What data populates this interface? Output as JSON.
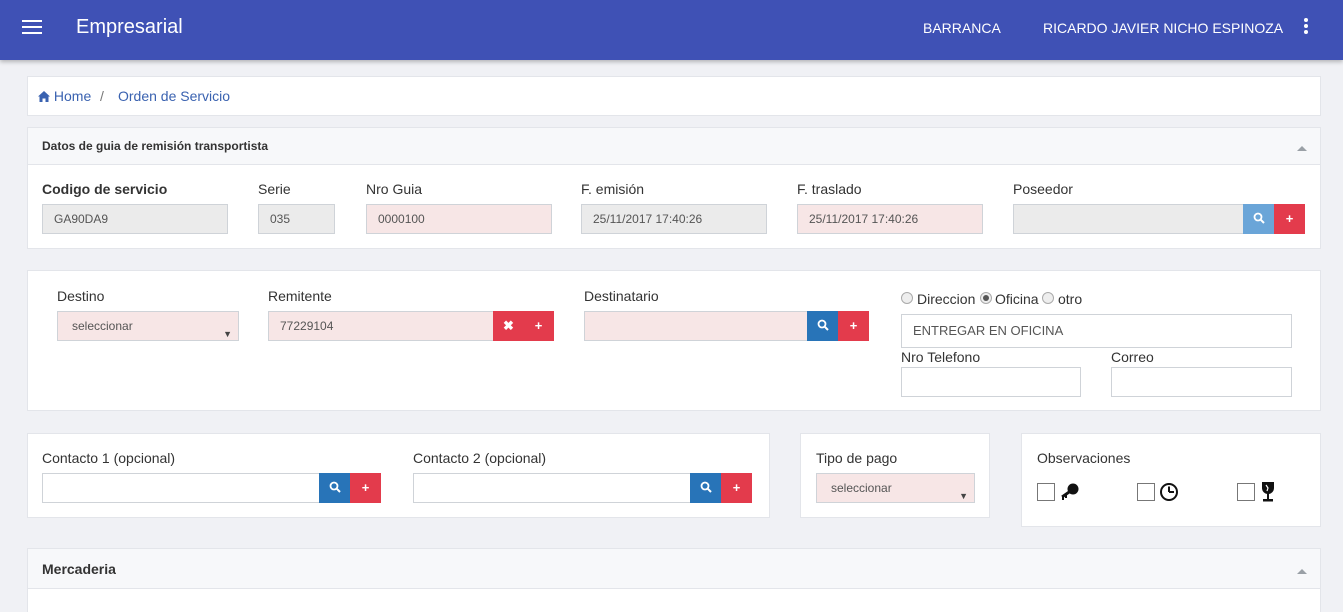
{
  "app": {
    "title": "Empresarial",
    "location": "BARRANCA",
    "user": "RICARDO JAVIER NICHO ESPINOZA"
  },
  "breadcrumb": {
    "home": "Home",
    "separator": "/",
    "current": "Orden de Servicio"
  },
  "guia": {
    "section_title": "Datos de guia de remisión transportista",
    "codigo": {
      "label": "Codigo de servicio",
      "value": "GA90DA9"
    },
    "serie": {
      "label": "Serie",
      "value": "035"
    },
    "nro_guia": {
      "label": "Nro Guia",
      "value": "0000100"
    },
    "f_emision": {
      "label": "F. emisión",
      "value": "25/11/2017 17:40:26"
    },
    "f_traslado": {
      "label": "F. traslado",
      "value": "25/11/2017 17:40:26"
    },
    "poseedor": {
      "label": "Poseedor",
      "value": ""
    }
  },
  "envio": {
    "destino": {
      "label": "Destino",
      "value": "seleccionar"
    },
    "remitente": {
      "label": "Remitente",
      "value": "77229104"
    },
    "destinatario": {
      "label": "Destinatario",
      "value": ""
    },
    "entrega_options": [
      "Direccion",
      "Oficina",
      "otro"
    ],
    "entrega_selected": "Oficina",
    "entrega_value": "ENTREGAR EN OFICINA",
    "telefono": {
      "label": "Nro Telefono",
      "value": ""
    },
    "correo": {
      "label": "Correo",
      "value": ""
    }
  },
  "contactos": {
    "contacto1": {
      "label": "Contacto 1 (opcional)",
      "value": ""
    },
    "contacto2": {
      "label": "Contacto 2 (opcional)",
      "value": ""
    }
  },
  "pago": {
    "label": "Tipo de pago",
    "value": "seleccionar"
  },
  "observaciones": {
    "label": "Observaciones",
    "icons": [
      "key-icon",
      "clock-icon",
      "fragile-glass-icon"
    ]
  },
  "mercaderia": {
    "section_title": "Mercaderia"
  },
  "icons": {
    "search": "search-icon",
    "add": "plus-icon",
    "clear": "times-icon",
    "home": "home-icon"
  },
  "colors": {
    "header": "#3f51b5",
    "blue_button": "#2874b8",
    "red_button": "#e33b4c",
    "required_bg": "#f7e6e6"
  }
}
